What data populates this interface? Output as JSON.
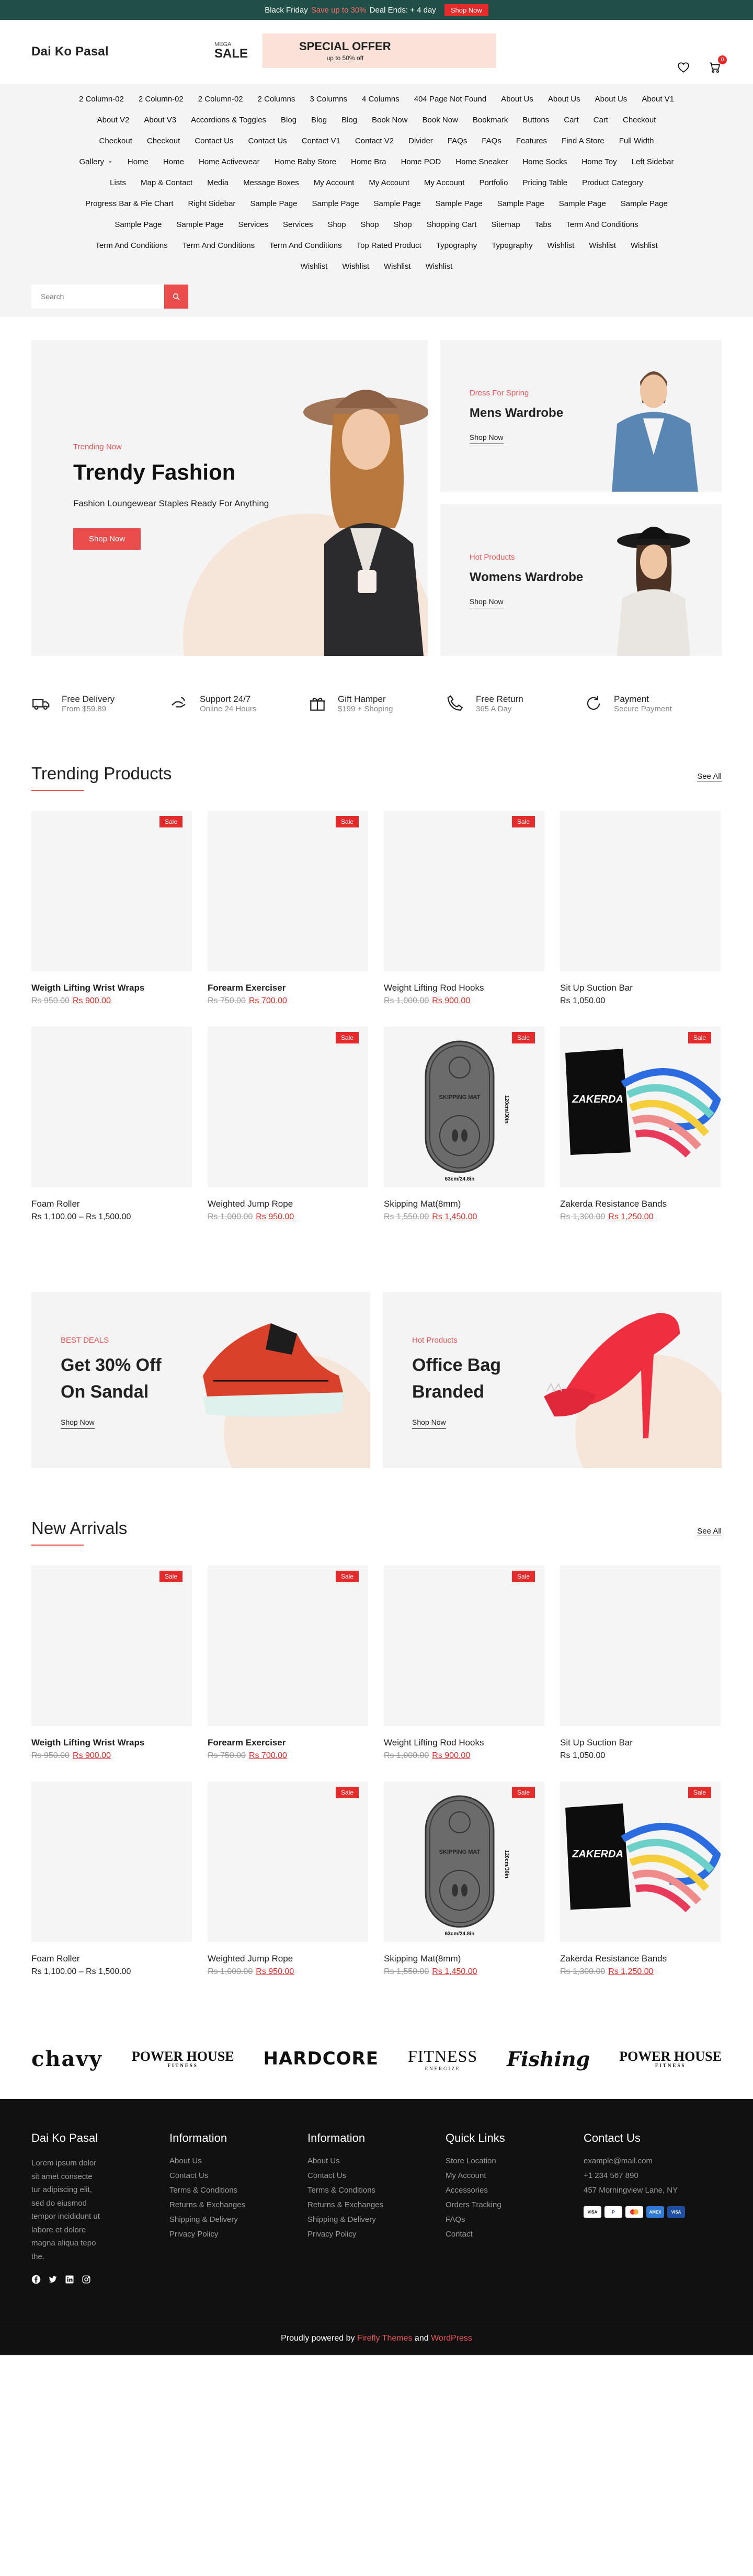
{
  "topbar": {
    "lead": "Black Friday",
    "highlight": "Save up to 30%",
    "tail": "Deal Ends: + 4 day",
    "button": "Shop Now"
  },
  "header": {
    "logo": "Dai Ko Pasal",
    "promo_small": "MEGA",
    "promo_big": "SALE",
    "promo_offer": "SPECIAL OFFER",
    "promo_sub": "up to 50% off",
    "cart_count": "0"
  },
  "nav": {
    "rows": [
      [
        "2 Column-02",
        "2 Column-02",
        "2 Column-02",
        "2 Columns",
        "3 Columns",
        "4 Columns",
        "404 Page Not Found",
        "About Us",
        "About Us",
        "About Us",
        "About V1"
      ],
      [
        "About V2",
        "About V3",
        "Accordions & Toggles",
        "Blog",
        "Blog",
        "Blog",
        "Book Now",
        "Book Now",
        "Bookmark",
        "Buttons",
        "Cart",
        "Cart",
        "Checkout"
      ],
      [
        "Checkout",
        "Checkout",
        "Contact Us",
        "Contact Us",
        "Contact V1",
        "Contact V2",
        "Divider",
        "FAQs",
        "FAQs",
        "Features",
        "Find A Store",
        "Full Width"
      ],
      [
        "Gallery",
        "Home",
        "Home",
        "Home Activewear",
        "Home Baby Store",
        "Home Bra",
        "Home POD",
        "Home Sneaker",
        "Home Socks",
        "Home Toy",
        "Left Sidebar"
      ],
      [
        "Lists",
        "Map & Contact",
        "Media",
        "Message Boxes",
        "My Account",
        "My Account",
        "My Account",
        "Portfolio",
        "Pricing Table",
        "Product Category"
      ],
      [
        "Progress Bar & Pie Chart",
        "Right Sidebar",
        "Sample Page",
        "Sample Page",
        "Sample Page",
        "Sample Page",
        "Sample Page",
        "Sample Page",
        "Sample Page"
      ],
      [
        "Sample Page",
        "Sample Page",
        "Services",
        "Services",
        "Shop",
        "Shop",
        "Shop",
        "Shopping Cart",
        "Sitemap",
        "Tabs",
        "Term And Conditions"
      ],
      [
        "Term And Conditions",
        "Term And Conditions",
        "Term And Conditions",
        "Top Rated Product",
        "Typography",
        "Typography",
        "Wishlist",
        "Wishlist",
        "Wishlist"
      ],
      [
        "Wishlist",
        "Wishlist",
        "Wishlist",
        "Wishlist"
      ]
    ],
    "search_placeholder": "Search"
  },
  "hero": {
    "eyebrow": "Trending Now",
    "title": "Trendy Fashion",
    "desc": "Fashion Loungewear Staples Ready For Anything",
    "button": "Shop Now",
    "side": [
      {
        "eyebrow": "Dress For Spring",
        "title": "Mens Wardrobe",
        "link": "Shop Now"
      },
      {
        "eyebrow": "Hot Products",
        "title": "Womens Wardrobe",
        "link": "Shop Now"
      }
    ]
  },
  "features": [
    {
      "icon": "truck-icon",
      "title": "Free Delivery",
      "sub": "From $59.89"
    },
    {
      "icon": "support-hand-icon",
      "title": "Support 24/7",
      "sub": "Online 24 Hours"
    },
    {
      "icon": "gift-icon",
      "title": "Gift Hamper",
      "sub": "$199 + Shoping"
    },
    {
      "icon": "phone-icon",
      "title": "Free Return",
      "sub": "365 A Day"
    },
    {
      "icon": "payment-refresh-icon",
      "title": "Payment",
      "sub": "Secure Payment"
    }
  ],
  "trending": {
    "title": "Trending Products",
    "see_all": "See All",
    "products": [
      {
        "name": "Weigth Lifting Wrist Wraps",
        "old": "Rs 950.00",
        "price": "Rs 900.00",
        "badge": "Sale"
      },
      {
        "name": "Forearm Exerciser",
        "old": "Rs 750.00",
        "price": "Rs 700.00",
        "badge": "Sale"
      },
      {
        "name": "Weight Lifting Rod Hooks",
        "old": "Rs 1,000.00",
        "price": "Rs 900.00",
        "badge": "Sale"
      },
      {
        "name": "Sit Up Suction Bar",
        "old": "",
        "price": "Rs 1,050.00",
        "badge": ""
      },
      {
        "name": "Foam Roller",
        "old": "",
        "price": "Rs 1,100.00 – Rs 1,500.00",
        "badge": ""
      },
      {
        "name": "Weighted Jump Rope",
        "old": "Rs 1,000.00",
        "price": "Rs 950.00",
        "badge": "Sale"
      },
      {
        "name": "Skipping Mat(8mm)",
        "old": "Rs 1,550.00",
        "price": "Rs 1,450.00",
        "badge": "Sale"
      },
      {
        "name": "Zakerda Resistance Bands",
        "old": "Rs 1,300.00",
        "price": "Rs 1,250.00",
        "badge": "Sale"
      }
    ]
  },
  "mat_text": {
    "top": "SKIPPING MAT",
    "side": "120cm/30in",
    "bottom": "63cm/24.8in"
  },
  "bands_text": "ZAKERDA",
  "banners": [
    {
      "eyebrow": "BEST DEALS",
      "title_l1": "Get 30% Off",
      "title_l2": "On Sandal",
      "link": "Shop Now"
    },
    {
      "eyebrow": "Hot Products",
      "title_l1": "Office Bag",
      "title_l2": "Branded",
      "link": "Shop Now"
    }
  ],
  "arrivals": {
    "title": "New Arrivals",
    "see_all": "See All"
  },
  "brands": {
    "chavy": "chavy",
    "power": "POWER HOUSE",
    "power_sub": "FITNESS",
    "hardcore": "HARDCORE",
    "fitness": "FITNESS",
    "fitness_sub": "ENERGIZE",
    "fishing": "Fishing"
  },
  "footer": {
    "logo": "Dai Ko Pasal",
    "about": "Lorem ipsum dolor sit amet consecte tur adipiscing elit, sed do eiusmod tempor incididunt ut labore et dolore magna aliqua tepo the.",
    "info1": {
      "title": "Information",
      "items": [
        "About Us",
        "Contact Us",
        "Terms & Conditions",
        "Returns & Exchanges",
        "Shipping & Delivery",
        "Privacy Policy"
      ]
    },
    "info2": {
      "title": "Information",
      "items": [
        "About Us",
        "Contact Us",
        "Terms & Conditions",
        "Returns & Exchanges",
        "Shipping & Delivery",
        "Privacy Policy"
      ]
    },
    "quick": {
      "title": "Quick Links",
      "items": [
        "Store Location",
        "My Account",
        "Accessories",
        "Orders Tracking",
        "FAQs",
        "Contact"
      ]
    },
    "contact": {
      "title": "Contact Us",
      "items": [
        "example@mail.com",
        "+1 234 567 890",
        "457 Morningview Lane, NY"
      ]
    },
    "bottom_pre": "Proudly powered by",
    "bottom_theme": "Firefly Themes",
    "bottom_and": "and",
    "bottom_wp": "WordPress"
  }
}
